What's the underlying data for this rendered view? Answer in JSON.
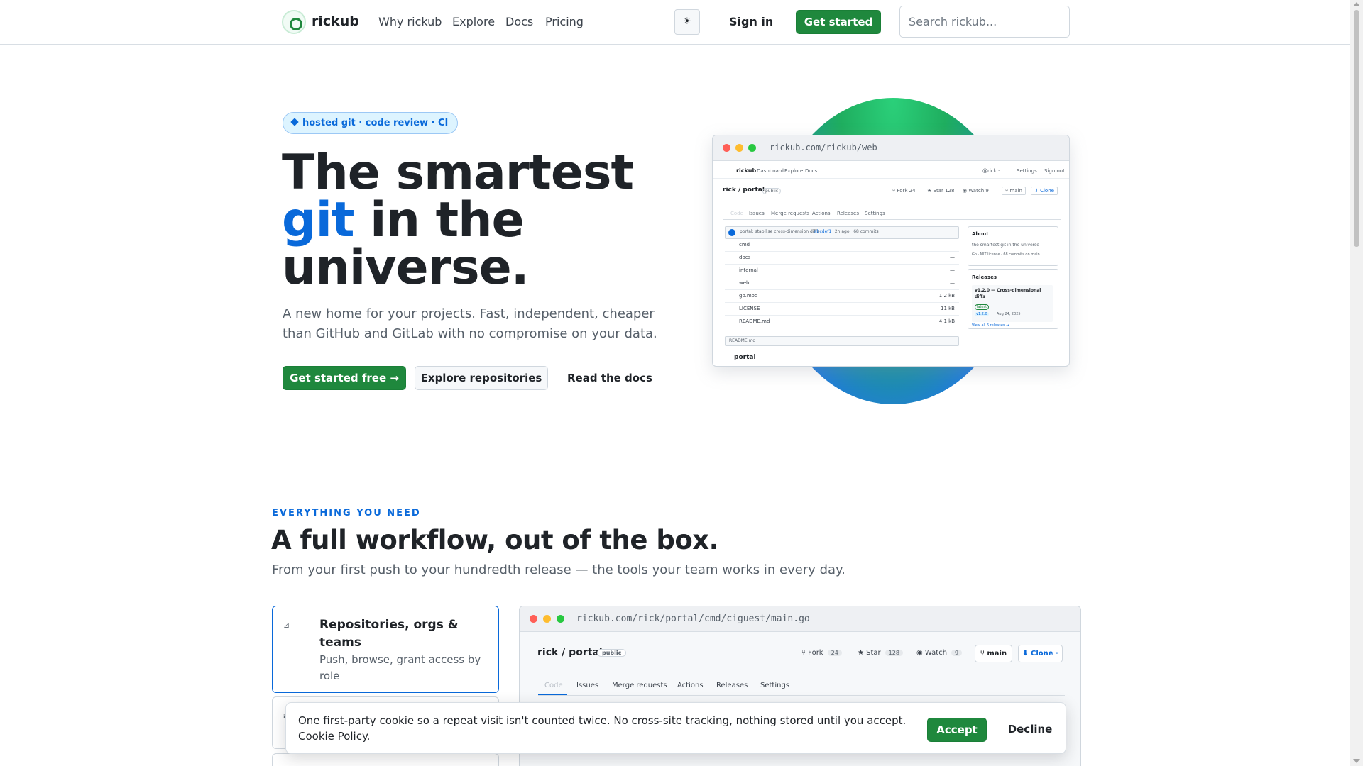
{
  "nav": {
    "brand": "rickub",
    "links": [
      "Why rickub",
      "Explore",
      "Docs",
      "Pricing"
    ],
    "theme_icon": "sun-icon",
    "theme_glyph": "☀",
    "sign_in": "Sign in",
    "get_started": "Get started",
    "search_placeholder": "Search rickub..."
  },
  "hero": {
    "tag": "hosted git · code review · CI",
    "title_line1": "The smartest",
    "title_accent": "git",
    "title_line2_rest": " in the",
    "title_line3": "universe.",
    "subtitle": "A new home for your projects. Fast, independent, cheaper than GitHub and GitLab with no compromise on your data.",
    "cta_primary": "Get started free →",
    "cta_secondary": "Explore repositories",
    "cta_text": "Read the docs",
    "mock": {
      "url": "rickub.com/rickub/web",
      "brand": "rickub",
      "nav": [
        "Dashboard",
        "Explore",
        "Docs"
      ],
      "user": "@rick ·",
      "settings": "Settings",
      "sign_out": "Sign out",
      "repo": "rick / portal",
      "visibility": "public",
      "fork": "⑂ Fork 24",
      "star": "★ Star 128",
      "watch": "◉ Watch 9",
      "branch": "⑂ main",
      "clone": "⬇ Clone",
      "tabs": [
        "Code",
        "Issues",
        "Merge requests",
        "Actions",
        "Releases",
        "Settings"
      ],
      "commit": "portal: stabilise cross-dimension diffs",
      "commit_hash": "abcdef1",
      "commit_meta": "· 2h ago · 68 commits",
      "files": [
        {
          "name": "cmd",
          "size": "—"
        },
        {
          "name": "docs",
          "size": "—"
        },
        {
          "name": "internal",
          "size": "—"
        },
        {
          "name": "web",
          "size": "—"
        },
        {
          "name": "go.mod",
          "size": "1.2 kB"
        },
        {
          "name": "LICENSE",
          "size": "11 kB"
        },
        {
          "name": "README.md",
          "size": "4.1 kB"
        }
      ],
      "about_title": "About",
      "about_text": "the smartest git in the universe",
      "about_meta": "Go · MIT license · 68 commits on main",
      "releases_title": "Releases",
      "release_name": "v1.2.0 — Cross-dimensional diffs",
      "release_badge": "latest",
      "release_tag": "v1.2.0",
      "release_date": "Aug 24, 2025",
      "releases_link": "View all 6 releases →",
      "readme_label": "README.md",
      "readme_title": "portal"
    }
  },
  "features": {
    "eyebrow": "EVERYTHING YOU NEED",
    "title": "A full workflow, out of the box.",
    "subtitle": "From your first push to your hundredth release — the tools your team works in every day.",
    "cards": [
      {
        "icon": "repo-icon",
        "glyph": "⊿",
        "title": "Repositories, orgs & teams",
        "desc": "Push, browse, grant access by role"
      },
      {
        "icon": "merge-icon",
        "glyph": "⇄",
        "title": "",
        "desc": ""
      }
    ],
    "mock": {
      "url": "rickub.com/rick/portal/cmd/ciguest/main.go",
      "repo": "rick / portal",
      "visibility": "public",
      "fork": "⑂ Fork",
      "fork_count": "24",
      "star": "★ Star",
      "star_count": "128",
      "watch": "◉ Watch",
      "watch_count": "9",
      "branch": "⑂ main",
      "clone": "⬇ Clone ·",
      "tabs": [
        "Code",
        "Issues",
        "Merge requests",
        "Actions",
        "Releases",
        "Settings"
      ]
    }
  },
  "cookie": {
    "text": "One first-party cookie so a repeat visit isn't counted twice. No cross-site tracking, nothing stored until you accept. Cookie Policy.",
    "accept": "Accept",
    "decline": "Decline"
  },
  "colors": {
    "accent_blue": "#0969da",
    "primary_green": "#1f883d",
    "text": "#1f2328",
    "muted": "#57606a"
  }
}
